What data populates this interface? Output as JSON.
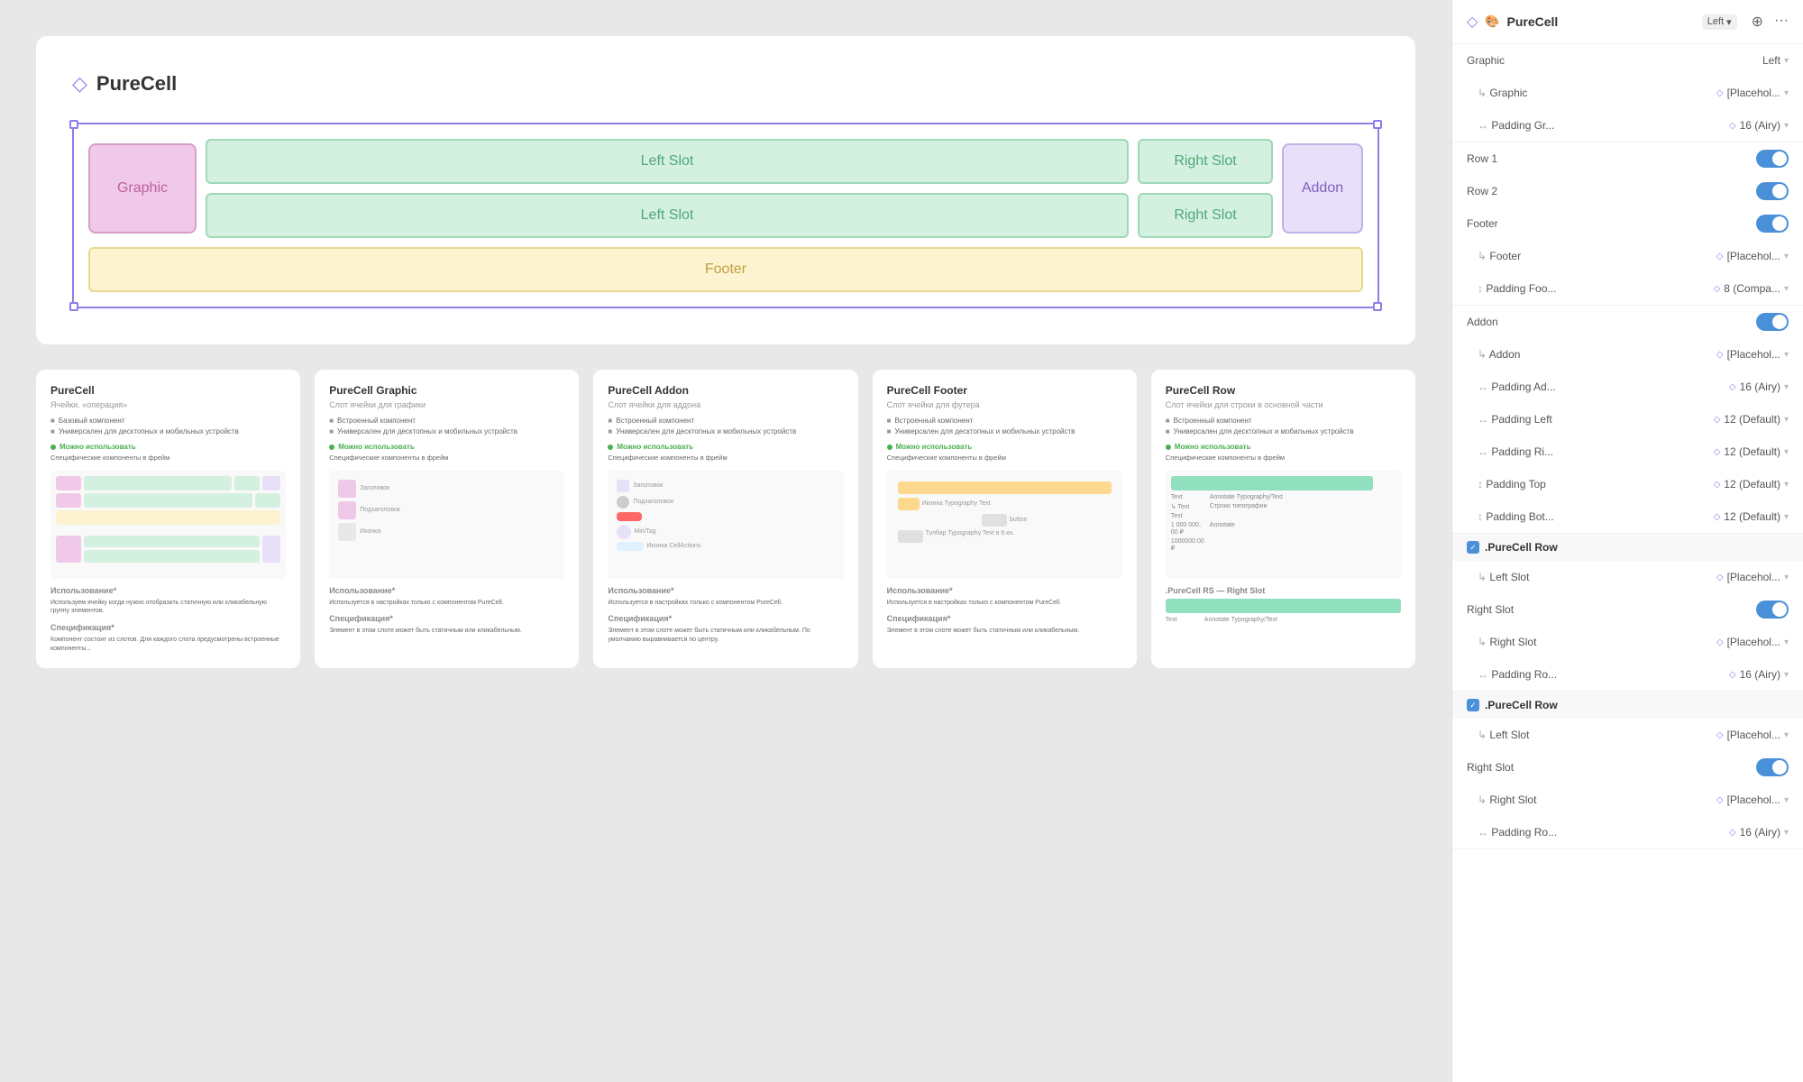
{
  "header": {
    "title": "PureCell",
    "icon": "◇",
    "dropdown": "▾",
    "actions": [
      "⊕",
      "···"
    ]
  },
  "main_card": {
    "title": "PureCell",
    "title_icon": "◇"
  },
  "diagram": {
    "graphic_label": "Graphic",
    "left_slot_1": "Left Slot",
    "left_slot_2": "Left Slot",
    "right_slot_1": "Right Slot",
    "right_slot_2": "Right Slot",
    "addon_label": "Addon",
    "footer_label": "Footer"
  },
  "doc_cards": [
    {
      "title": "PureCell",
      "subtitle": "Ячейки. «операция»",
      "bullets": [
        "Базовый компонент",
        "Универсален для десктопных и мобильных устройств"
      ],
      "usage_label": "Можно использовать",
      "usage_text": "Специфические компоненты в фрейм"
    },
    {
      "title": "PureCell Graphic",
      "subtitle": "Слот ячейки для графики",
      "bullets": [
        "Встроенный компонент",
        "Универсален для десктопных и мобильных устройств"
      ],
      "usage_label": "Можно использовать",
      "usage_text": "Специфические компоненты в фрейм"
    },
    {
      "title": "PureCell Addon",
      "subtitle": "Слот ячейки для аддона",
      "bullets": [
        "Встроенный компонент",
        "Универсален для десктопных и мобильных устройств"
      ],
      "usage_label": "Можно использовать",
      "usage_text": "Специфические компоненты в фрейм"
    },
    {
      "title": "PureCell Footer",
      "subtitle": "Слот ячейки для футера",
      "bullets": [
        "Встроенный компонент",
        "Универсален для десктопных и мобильных устройств"
      ],
      "usage_label": "Можно использовать",
      "usage_text": "Специфические компоненты в фрейм"
    },
    {
      "title": "PureCell Row",
      "subtitle": "Слот ячейки для строки в основной части",
      "bullets": [
        "Встроенный компонент",
        "Универсален для десктопных и мобильных устройств"
      ],
      "usage_label": "Можно использовать",
      "usage_text": "Специфические компоненты в фрейм"
    }
  ],
  "panel": {
    "title": "PureCell",
    "title_icon": "◇",
    "dropdown_label": "Left",
    "rows": [
      {
        "type": "header",
        "label": "Graphic",
        "value": "Left",
        "has_dropdown": true
      },
      {
        "type": "indent",
        "label": "Graphic",
        "value": "[Placehol...",
        "has_diamond": true
      },
      {
        "type": "indent2",
        "label": "Padding Gr...",
        "value": "16 (Airy)",
        "has_diamond": true
      },
      {
        "type": "normal",
        "label": "Row 1",
        "is_toggle": true,
        "toggle_on": true
      },
      {
        "type": "normal",
        "label": "Row 2",
        "is_toggle": true,
        "toggle_on": true
      },
      {
        "type": "normal",
        "label": "Footer",
        "is_toggle": true,
        "toggle_on": true
      },
      {
        "type": "indent",
        "label": "Footer",
        "value": "[Placehol...",
        "has_diamond": true
      },
      {
        "type": "indent3",
        "label": "Padding Foo...",
        "value": "8 (Compa...",
        "has_diamond": true
      },
      {
        "type": "normal",
        "label": "Addon",
        "is_toggle": true,
        "toggle_on": true
      },
      {
        "type": "indent",
        "label": "Addon",
        "value": "[Placehol...",
        "has_diamond": true
      },
      {
        "type": "indent2",
        "label": "Padding Ad...",
        "value": "16 (Airy)",
        "has_diamond": true
      },
      {
        "type": "indent2",
        "label": "Padding Left",
        "value": "12 (Default)",
        "has_diamond": true
      },
      {
        "type": "indent2",
        "label": "Padding Ri...",
        "value": "12 (Default)",
        "has_diamond": true
      },
      {
        "type": "indent3",
        "label": "Padding Top",
        "value": "12 (Default)",
        "has_diamond": true
      },
      {
        "type": "indent3",
        "label": "Padding Bot...",
        "value": "12 (Default)",
        "has_diamond": true
      }
    ],
    "section1": {
      "title": ".PureCell Row",
      "rows": [
        {
          "type": "indent",
          "label": "Left Slot",
          "value": "[Placehol...",
          "has_diamond": true
        },
        {
          "type": "normal",
          "label": "Right Slot",
          "is_toggle": true,
          "toggle_on": true
        },
        {
          "type": "indent",
          "label": "Right Slot",
          "value": "[Placehol...",
          "has_diamond": true
        },
        {
          "type": "indent2",
          "label": "Padding Ro...",
          "value": "16 (Airy)",
          "has_diamond": true
        }
      ]
    },
    "section2": {
      "title": ".PureCell Row",
      "rows": [
        {
          "type": "indent",
          "label": "Left Slot",
          "value": "[Placehol...",
          "has_diamond": true
        },
        {
          "type": "normal",
          "label": "Right Slot",
          "is_toggle": true,
          "toggle_on": true
        },
        {
          "type": "indent",
          "label": "Right Slot",
          "value": "[Placehol...",
          "has_diamond": true
        },
        {
          "type": "indent2",
          "label": "Padding Ro...",
          "value": "16 (Airy)",
          "has_diamond": true
        }
      ]
    }
  }
}
